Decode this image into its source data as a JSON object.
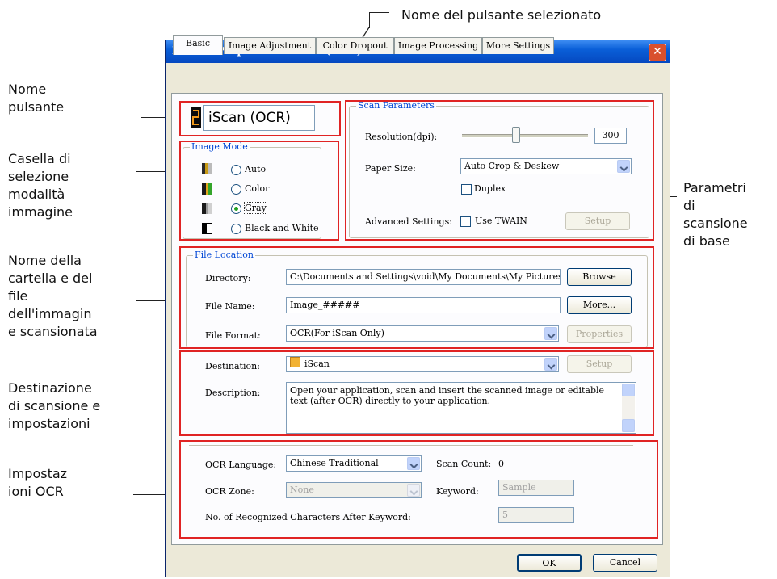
{
  "annotations": {
    "top": "Nome del pulsante selezionato",
    "button_name": "Nome\npulsante",
    "image_mode": "Casella di\nselezione\nmodalità\nimmagine",
    "folder_file": "Nome della\ncartella e del\nfile\ndell'immagin\ne scansionata",
    "destination": "Destinazione\ndi scansione e\nimpostazioni",
    "ocr": "Impostaz\nioni OCR",
    "scan_params": "Parametri\ndi\nscansione\ndi base"
  },
  "window": {
    "title": "Button Properties - iScan (OCR)"
  },
  "tabs": [
    {
      "label": "Basic",
      "active": true
    },
    {
      "label": "Image Adjustment",
      "active": false
    },
    {
      "label": "Color Dropout",
      "active": false
    },
    {
      "label": "Image Processing",
      "active": false
    },
    {
      "label": "More Settings",
      "active": false
    }
  ],
  "button_name": {
    "number": "2",
    "value": "iScan (OCR)"
  },
  "image_mode": {
    "legend": "Image Mode",
    "options": [
      {
        "label": "Auto",
        "selected": false
      },
      {
        "label": "Color",
        "selected": false
      },
      {
        "label": "Gray",
        "selected": true
      },
      {
        "label": "Black and White",
        "selected": false
      }
    ]
  },
  "scan_parameters": {
    "legend": "Scan Parameters",
    "resolution_label": "Resolution(dpi):",
    "resolution_value": "300",
    "paper_size_label": "Paper Size:",
    "paper_size_value": "Auto Crop & Deskew",
    "duplex_label": "Duplex",
    "advanced_label": "Advanced Settings:",
    "use_twain_label": "Use TWAIN",
    "setup_label": "Setup"
  },
  "file_location": {
    "legend": "File Location",
    "directory_label": "Directory:",
    "directory_value": "C:\\Documents and Settings\\void\\My Documents\\My Pictures",
    "browse_label": "Browse",
    "file_name_label": "File Name:",
    "file_name_value": "Image_#####",
    "more_label": "More...",
    "file_format_label": "File Format:",
    "file_format_value": "OCR(For iScan Only)",
    "properties_label": "Properties"
  },
  "destination": {
    "label": "Destination:",
    "value": "iScan",
    "setup_label": "Setup",
    "description_label": "Description:",
    "description_value": "Open your application, scan and insert the scanned image or editable text (after OCR) directly to your application."
  },
  "ocr": {
    "language_label": "OCR Language:",
    "language_value": "Chinese Traditional",
    "scan_count_label": "Scan Count:",
    "scan_count_value": "0",
    "zone_label": "OCR Zone:",
    "zone_value": "None",
    "keyword_label": "Keyword:",
    "keyword_value": "Sample",
    "recognized_label": "No. of Recognized Characters After Keyword:",
    "recognized_value": "5"
  },
  "footer": {
    "ok_label": "OK",
    "cancel_label": "Cancel"
  }
}
